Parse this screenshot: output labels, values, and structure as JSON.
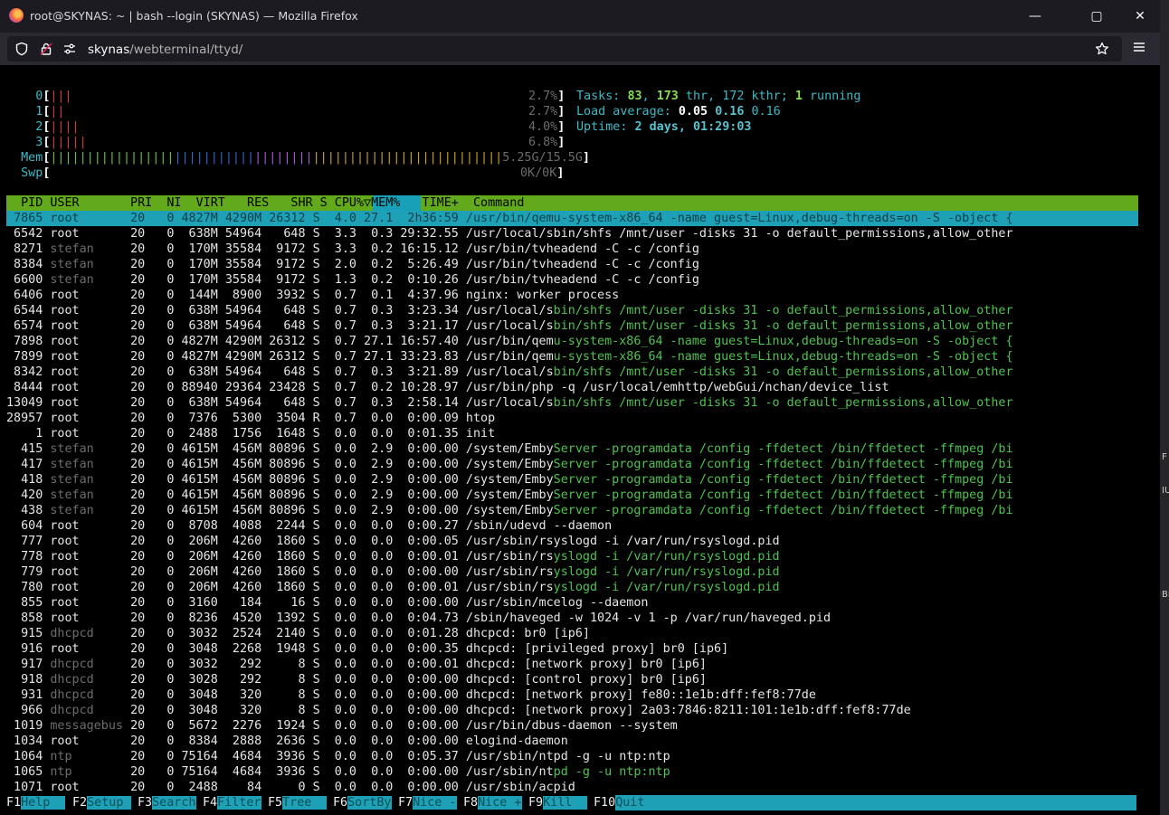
{
  "window": {
    "title": "root@SKYNAS: ~ | bash --login (SKYNAS) — Mozilla Firefox",
    "controls": {
      "minimize": "—",
      "maximize": "▢",
      "close": "✕"
    }
  },
  "navbar": {
    "url_host": "skynas",
    "url_path": "/webterminal/ttyd/",
    "icons": [
      "shield-icon",
      "lock-icon",
      "permissions-icon",
      "bookmark-star-icon",
      "menu-icon"
    ]
  },
  "right_strip": {
    "fragments": [
      "F",
      "IU",
      "BI"
    ]
  },
  "meters": {
    "cpus": [
      {
        "label": "0",
        "bar": "|||",
        "value": "2.7%"
      },
      {
        "label": "1",
        "bar": "||",
        "value": "2.7%"
      },
      {
        "label": "2",
        "bar": "||||",
        "value": "4.0%"
      },
      {
        "label": "3",
        "bar": "|||||",
        "value": "6.8%"
      }
    ],
    "mem": {
      "label": "Mem",
      "value": "5.25G/15.5G"
    },
    "swp": {
      "label": "Swp",
      "value": "0K/0K"
    },
    "tasks": {
      "label": "Tasks: ",
      "procs": "83",
      "threads": "173",
      "thr_label": " thr, ",
      "kthreads": "172 kthr",
      "running": "1",
      "running_label": " running"
    },
    "load": {
      "label": "Load average: ",
      "l1": "0.05",
      "l5": "0.16",
      "l15": "0.16"
    },
    "uptime": {
      "label": "Uptime: ",
      "value": "2 days, 01:29:03"
    }
  },
  "table": {
    "header": "  PID USER       PRI  NI  VIRT   RES   SHR S ",
    "header_sort": "CPU%▽",
    "header_rest": "MEM%   TIME+  Command",
    "rows": [
      "7865 root       20   0 4827M 4290M 26312 S  4.0 27.1  2h36:59 /usr/bin/qemu-system-x86_64 -name guest=Linux,debug-threads=on -S -object {",
      "6542 root       20   0  638M 54964   648 S  3.3  0.3 29:32.55 /usr/local/sbin/shfs /mnt/user -disks 31 -o default_permissions,allow_other",
      "8271 stefan     20   0  170M 35584  9172 S  3.3  0.2 16:15.12 /usr/bin/tvheadend -C -c /config",
      "8384 stefan     20   0  170M 35584  9172 S  2.0  0.2  5:26.49 /usr/bin/tvheadend -C -c /config",
      "6600 stefan     20   0  170M 35584  9172 S  1.3  0.2  0:10.26 /usr/bin/tvheadend -C -c /config",
      "6406 root       20   0  144M  8900  3932 S  0.7  0.1  4:37.96 nginx: worker process",
      "6544 root       20   0  638M 54964   648 S  0.7  0.3  3:23.34 /usr/local/sbin/shfs /mnt/user -disks 31 -o default_permissions,allow_other",
      "6574 root       20   0  638M 54964   648 S  0.7  0.3  3:21.17 /usr/local/sbin/shfs /mnt/user -disks 31 -o default_permissions,allow_other",
      "7898 root       20   0 4827M 4290M 26312 S  0.7 27.1 16:57.40 /usr/bin/qemu-system-x86_64 -name guest=Linux,debug-threads=on -S -object {",
      "7899 root       20   0 4827M 4290M 26312 S  0.7 27.1 33:23.83 /usr/bin/qemu-system-x86_64 -name guest=Linux,debug-threads=on -S -object {",
      "8342 root       20   0  638M 54964   648 S  0.7  0.3  3:21.89 /usr/local/sbin/shfs /mnt/user -disks 31 -o default_permissions,allow_other",
      "8444 root       20   0 88940 29364 23428 S  0.7  0.2 10:28.97 /usr/bin/php -q /usr/local/emhttp/webGui/nchan/device_list",
      "13049 root       20   0  638M 54964   648 S  0.7  0.3  2:58.14 /usr/local/sbin/shfs /mnt/user -disks 31 -o default_permissions,allow_other",
      "28957 root       20   0  7376  5300  3504 R  0.7  0.0  0:00.09 htop",
      "1 root       20   0  2488  1756  1648 S  0.0  0.0  0:01.35 init",
      "415 stefan     20   0 4615M  456M 80896 S  0.0  2.9  0:00.00 /system/EmbyServer -programdata /config -ffdetect /bin/ffdetect -ffmpeg /bi",
      "417 stefan     20   0 4615M  456M 80896 S  0.0  2.9  0:00.00 /system/EmbyServer -programdata /config -ffdetect /bin/ffdetect -ffmpeg /bi",
      "418 stefan     20   0 4615M  456M 80896 S  0.0  2.9  0:00.00 /system/EmbyServer -programdata /config -ffdetect /bin/ffdetect -ffmpeg /bi",
      "420 stefan     20   0 4615M  456M 80896 S  0.0  2.9  0:00.00 /system/EmbyServer -programdata /config -ffdetect /bin/ffdetect -ffmpeg /bi",
      "438 stefan     20   0 4615M  456M 80896 S  0.0  2.9  0:00.00 /system/EmbyServer -programdata /config -ffdetect /bin/ffdetect -ffmpeg /bi",
      "604 root       20   0  8708  4088  2244 S  0.0  0.0  0:00.27 /sbin/udevd --daemon",
      "777 root       20   0  206M  4260  1860 S  0.0  0.0  0:00.05 /usr/sbin/rsyslogd -i /var/run/rsyslogd.pid",
      "778 root       20   0  206M  4260  1860 S  0.0  0.0  0:00.01 /usr/sbin/rsyslogd -i /var/run/rsyslogd.pid",
      "779 root       20   0  206M  4260  1860 S  0.0  0.0  0:00.00 /usr/sbin/rsyslogd -i /var/run/rsyslogd.pid",
      "780 root       20   0  206M  4260  1860 S  0.0  0.0  0:00.01 /usr/sbin/rsyslogd -i /var/run/rsyslogd.pid",
      "855 root       20   0  3160   184    16 S  0.0  0.0  0:00.00 /usr/sbin/mcelog --daemon",
      "858 root       20   0  8236  4520  1392 S  0.0  0.0  0:04.73 /sbin/haveged -w 1024 -v 1 -p /var/run/haveged.pid",
      "915 dhcpcd     20   0  3032  2524  2140 S  0.0  0.0  0:01.28 dhcpcd: br0 [ip6]",
      "916 root       20   0  3048  2268  1948 S  0.0  0.0  0:00.35 dhcpcd: [privileged proxy] br0 [ip6]",
      "917 dhcpcd     20   0  3032   292     8 S  0.0  0.0  0:00.01 dhcpcd: [network proxy] br0 [ip6]",
      "918 dhcpcd     20   0  3028   292     8 S  0.0  0.0  0:00.00 dhcpcd: [control proxy] br0 [ip6]",
      "931 dhcpcd     20   0  3048   320     8 S  0.0  0.0  0:00.00 dhcpcd: [network proxy] fe80::1e1b:dff:fef8:77de",
      "966 dhcpcd     20   0  3048   320     8 S  0.0  0.0  0:00.00 dhcpcd: [network proxy] 2a03:7846:8211:101:1e1b:dff:fef8:77de",
      "1019 messagebus 20   0  5672  2276  1924 S  0.0  0.0  0:00.00 /usr/bin/dbus-daemon --system",
      "1034 root       20   0  8384  2888  2636 S  0.0  0.0  0:00.00 elogind-daemon",
      "1064 ntp        20   0 75164  4684  3936 S  0.0  0.0  0:05.37 /usr/sbin/ntpd -g -u ntp:ntp",
      "1065 ntp        20   0 75164  4684  3936 S  0.0  0.0  0:00.00 /usr/sbin/ntpd -g -u ntp:ntp",
      "1071 root       20   0  2488    84     0 S  0.0  0.0  0:00.00 /usr/sbin/acpid"
    ],
    "selected_index": 0,
    "thread_rows": [
      6,
      7,
      8,
      9,
      10,
      12,
      15,
      16,
      17,
      18,
      19,
      22,
      23,
      24,
      36
    ],
    "dim_user_rows": [
      2,
      3,
      4,
      15,
      16,
      17,
      18,
      19,
      27,
      29,
      30,
      31,
      32,
      33,
      35,
      36
    ]
  },
  "function_keys": [
    {
      "key": "F1",
      "label": "Help  "
    },
    {
      "key": "F2",
      "label": "Setup "
    },
    {
      "key": "F3",
      "label": "Search"
    },
    {
      "key": "F4",
      "label": "Filter"
    },
    {
      "key": "F5",
      "label": "Tree  "
    },
    {
      "key": "F6",
      "label": "SortBy"
    },
    {
      "key": "F7",
      "label": "Nice -"
    },
    {
      "key": "F8",
      "label": "Nice +"
    },
    {
      "key": "F9",
      "label": "Kill  "
    },
    {
      "key": "F10",
      "label": "Quit"
    }
  ],
  "colors": {
    "header_green": "#62a91c",
    "selection_cyan": "#1ea1b6",
    "terminal_bg": "#000000",
    "thread_green": "#4fc34f"
  }
}
